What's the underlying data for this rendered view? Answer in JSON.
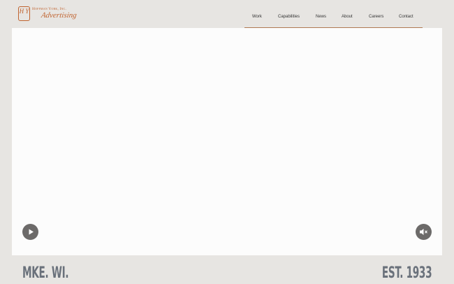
{
  "brand": {
    "seal_letters": "H Y",
    "line1": "Hoffman York, Inc.",
    "line2": "Advertising"
  },
  "nav": {
    "items": [
      {
        "label": "Work"
      },
      {
        "label": "Capabilities"
      },
      {
        "label": "News"
      },
      {
        "label": "About"
      },
      {
        "label": "Careers"
      },
      {
        "label": "Contact"
      }
    ]
  },
  "hero": {
    "controls": {
      "play_icon": "play-icon",
      "mute_icon": "speaker-muted-icon"
    }
  },
  "footer": {
    "left_text": "MKE. WI.",
    "right_text": "EST. 1933"
  },
  "colors": {
    "accent": "#c0632f",
    "nav_underline": "#b07a52",
    "background": "#e7e5e2",
    "control_bg": "#6c6a69",
    "footer_text": "#6a717b"
  }
}
